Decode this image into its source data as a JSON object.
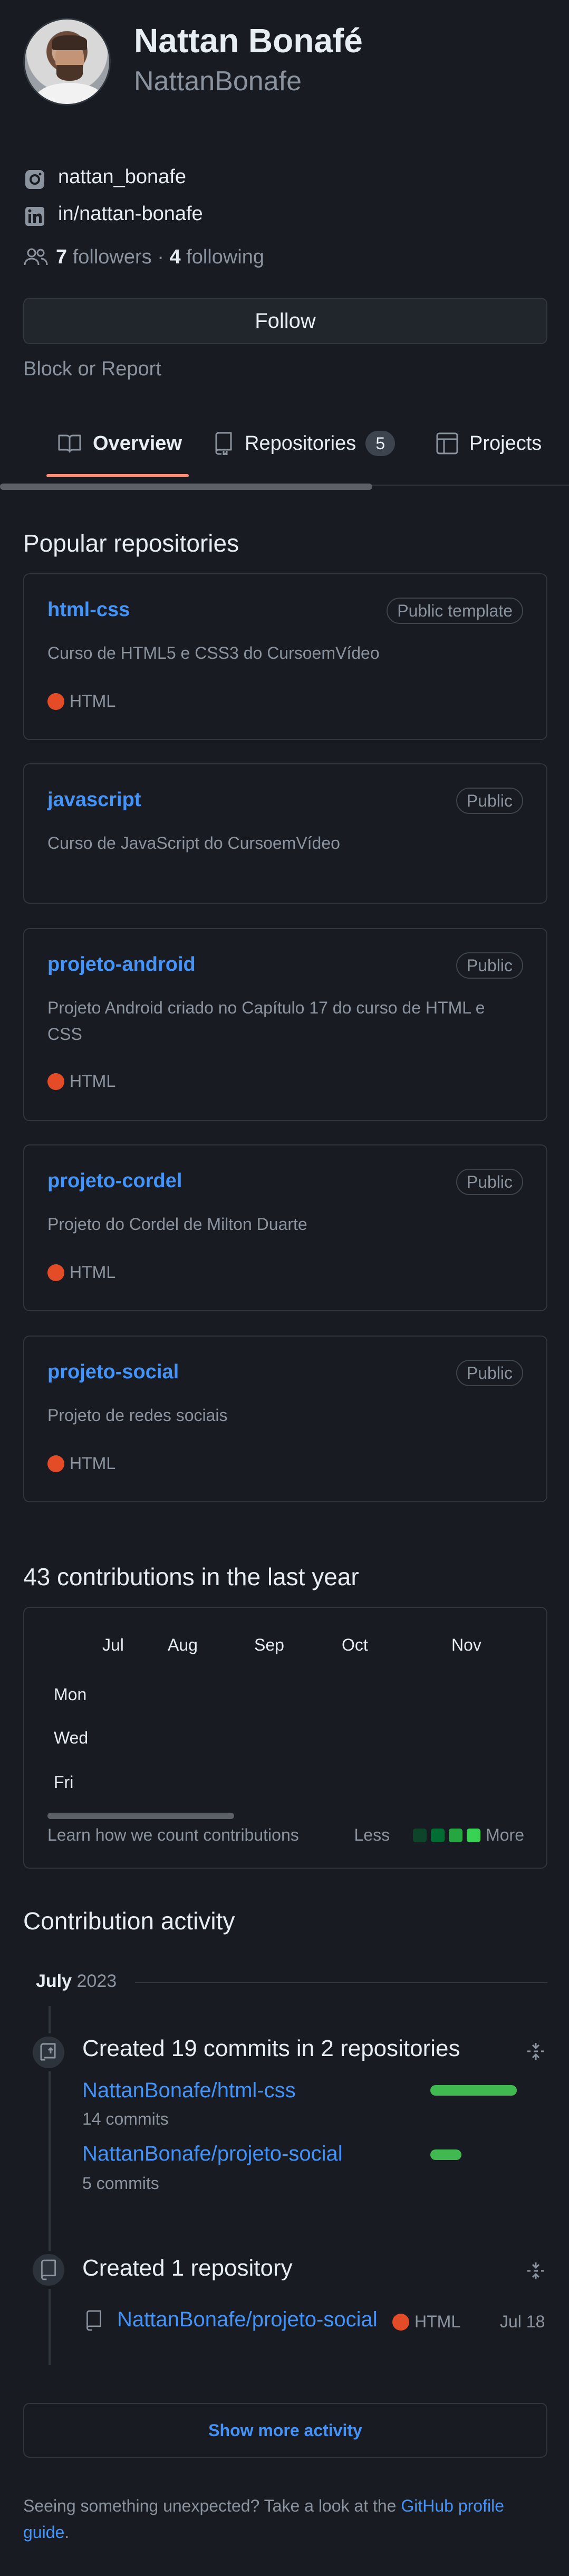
{
  "profile": {
    "name": "Nattan Bonafé",
    "login": "NattanBonafe",
    "instagram": "nattan_bonafe",
    "linkedin": "in/nattan-bonafe",
    "followers_count": "7",
    "followers_label": "followers",
    "separator": "·",
    "following_count": "4",
    "following_label": "following",
    "follow_button": "Follow",
    "block_report": "Block or Report"
  },
  "tabs": [
    {
      "label": "Overview",
      "icon": "book-icon",
      "selected": true
    },
    {
      "label": "Repositories",
      "icon": "repo-icon",
      "count": "5"
    },
    {
      "label": "Projects",
      "icon": "table-icon"
    }
  ],
  "popular": {
    "heading": "Popular repositories",
    "repos": [
      {
        "name": "html-css",
        "visibility": "Public template",
        "description": "Curso de HTML5 e CSS3 do CursoemVídeo",
        "language": "HTML"
      },
      {
        "name": "javascript",
        "visibility": "Public",
        "description": "Curso de JavaScript do CursoemVídeo",
        "language": ""
      },
      {
        "name": "projeto-android",
        "visibility": "Public",
        "description": "Projeto Android criado no Capítulo 17 do curso de HTML e CSS",
        "language": "HTML"
      },
      {
        "name": "projeto-cordel",
        "visibility": "Public",
        "description": "Projeto do Cordel de Milton Duarte",
        "language": "HTML"
      },
      {
        "name": "projeto-social",
        "visibility": "Public",
        "description": "Projeto de redes sociais",
        "language": "HTML"
      }
    ]
  },
  "contributions": {
    "heading": "43 contributions in the last year",
    "months": [
      "Jul",
      "Aug",
      "Sep",
      "Oct",
      "Nov"
    ],
    "days": [
      "Mon",
      "Wed",
      "Fri"
    ],
    "learn": "Learn how we count contributions",
    "less": "Less",
    "more": "More",
    "legend_colors": [
      "#161b22",
      "#0e4429",
      "#006d32",
      "#26a641",
      "#39d353"
    ]
  },
  "activity": {
    "heading": "Contribution activity",
    "month": "July",
    "year": "2023",
    "commits_event": {
      "title": "Created 19 commits in 2 repositories",
      "items": [
        {
          "repo": "NattanBonafe/html-css",
          "commits": "14 commits",
          "share": 14
        },
        {
          "repo": "NattanBonafe/projeto-social",
          "commits": "5 commits",
          "share": 5
        }
      ]
    },
    "repo_event": {
      "title": "Created 1 repository",
      "repo": "NattanBonafe/projeto-social",
      "language": "HTML",
      "date": "Jul 18"
    },
    "show_more": "Show more activity"
  },
  "footer": {
    "text": "Seeing something unexpected? Take a look at the",
    "link": "GitHub profile guide",
    "end": "."
  },
  "colors": {
    "background": "#181c22",
    "link": "#4493f8",
    "html_language": "#e34c26",
    "tab_underline": "#fd8c73",
    "bar": "#3fb950"
  }
}
